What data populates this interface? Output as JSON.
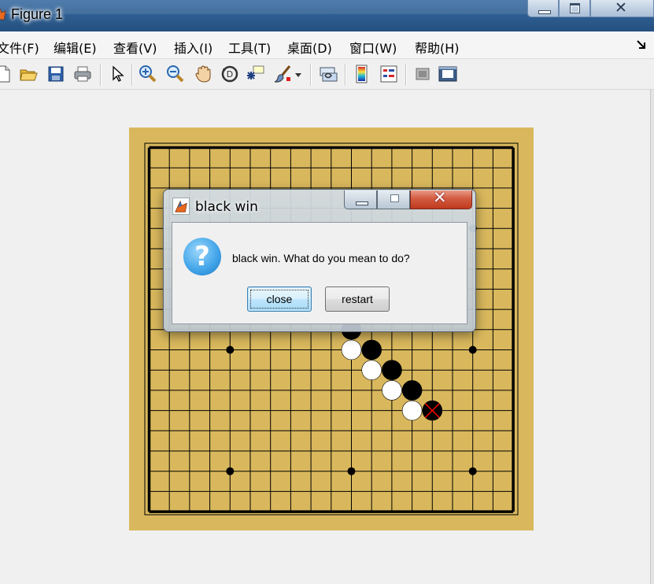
{
  "window": {
    "title": "Figure 1",
    "close_glyph": "✕"
  },
  "menu": [
    {
      "label": "文件(F)"
    },
    {
      "label": "编辑(E)"
    },
    {
      "label": "查看(V)"
    },
    {
      "label": "插入(I)"
    },
    {
      "label": "工具(T)"
    },
    {
      "label": "桌面(D)"
    },
    {
      "label": "窗口(W)"
    },
    {
      "label": "帮助(H)"
    }
  ],
  "toolbar": {
    "icons": [
      "new-figure-icon",
      "open-file-icon",
      "save-icon",
      "print-icon",
      "edit-plot-arrow-icon",
      "zoom-in-icon",
      "zoom-out-icon",
      "pan-hand-icon",
      "rotate-3d-icon",
      "data-cursor-icon",
      "brush-icon",
      "link-plot-icon",
      "colorbar-icon",
      "legend-icon",
      "hide-plot-tools-icon",
      "show-plot-tools-icon"
    ]
  },
  "board": {
    "size": 19,
    "background": "#d9b85d",
    "line_color": "#000000",
    "star_points": [
      [
        4,
        4
      ],
      [
        4,
        10
      ],
      [
        4,
        16
      ],
      [
        10,
        4
      ],
      [
        10,
        10
      ],
      [
        10,
        16
      ],
      [
        16,
        4
      ],
      [
        16,
        10
      ],
      [
        16,
        16
      ]
    ],
    "stones": [
      {
        "color": "black",
        "col": 10,
        "row": 9
      },
      {
        "color": "white",
        "col": 10,
        "row": 10
      },
      {
        "color": "black",
        "col": 11,
        "row": 10
      },
      {
        "color": "white",
        "col": 11,
        "row": 11
      },
      {
        "color": "black",
        "col": 12,
        "row": 11
      },
      {
        "color": "white",
        "col": 12,
        "row": 12
      },
      {
        "color": "black",
        "col": 13,
        "row": 12
      },
      {
        "color": "white",
        "col": 13,
        "row": 13
      },
      {
        "color": "black",
        "col": 14,
        "row": 13,
        "last_move": true
      }
    ],
    "last_move_marker_color": "#ff0000"
  },
  "dialog": {
    "title": "black win",
    "message": "black win. What do you mean to do?",
    "icon": "question-icon",
    "close_glyph": "✕",
    "buttons": {
      "close": "close",
      "restart": "restart"
    }
  }
}
